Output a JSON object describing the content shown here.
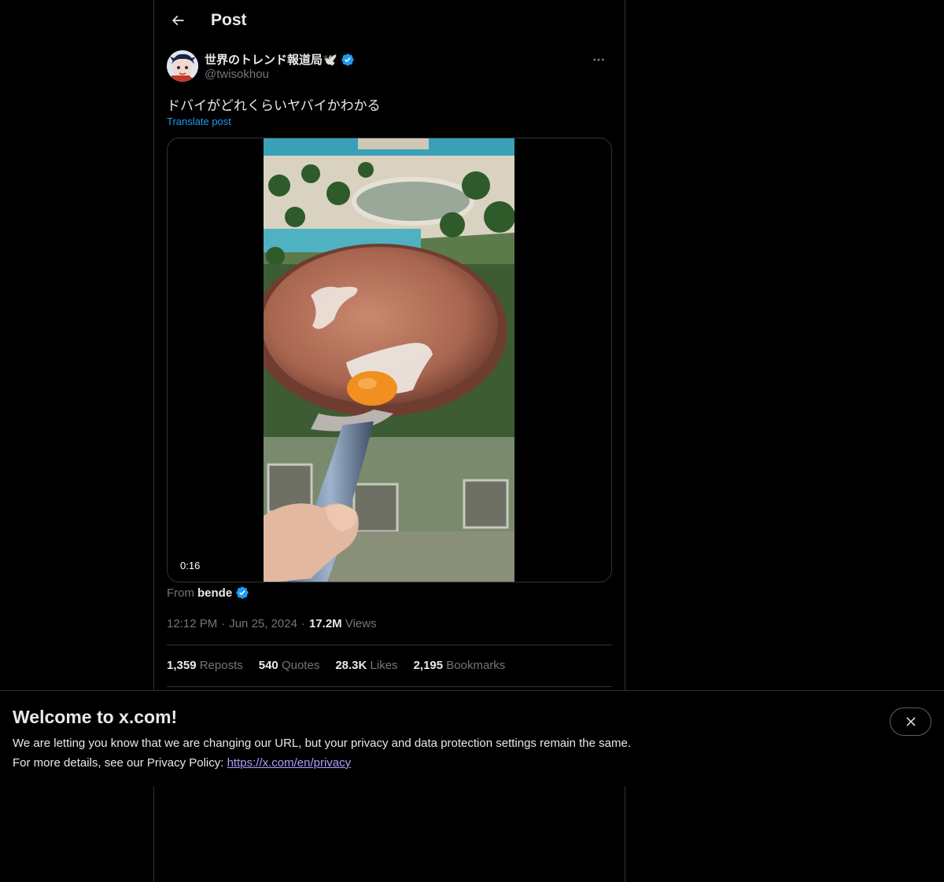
{
  "header": {
    "title": "Post",
    "back_icon": "arrow-left-icon"
  },
  "author": {
    "display_name": "世界のトレンド報道局🕊️",
    "handle": "@twisokhou",
    "verified": true,
    "verified_color": "#1d9bf0"
  },
  "post": {
    "text": "ドバイがどれくらいヤバイかわかる",
    "translate_label": "Translate post",
    "video_duration": "0:16"
  },
  "attribution": {
    "from_label": "From",
    "from_name": "bende",
    "verified": true
  },
  "meta": {
    "time": "12:12 PM",
    "sep1": "·",
    "date": "Jun 25, 2024",
    "sep2": "·",
    "views_count": "17.2M",
    "views_label": "Views"
  },
  "stats": [
    {
      "num": "1,359",
      "label": "Reposts"
    },
    {
      "num": "540",
      "label": "Quotes"
    },
    {
      "num": "28.3K",
      "label": "Likes"
    },
    {
      "num": "2,195",
      "label": "Bookmarks"
    }
  ],
  "banner": {
    "title": "Welcome to x.com!",
    "line1": "We are letting you know that we are changing our URL, but your privacy and data protection settings remain the same.",
    "line2_prefix": "For more details, see our Privacy Policy: ",
    "link": "https://x.com/en/privacy"
  },
  "colors": {
    "background": "#000000",
    "text_primary": "#e7e9ea",
    "text_secondary": "#71767b",
    "accent": "#1d9bf0",
    "border": "#2f3336"
  }
}
